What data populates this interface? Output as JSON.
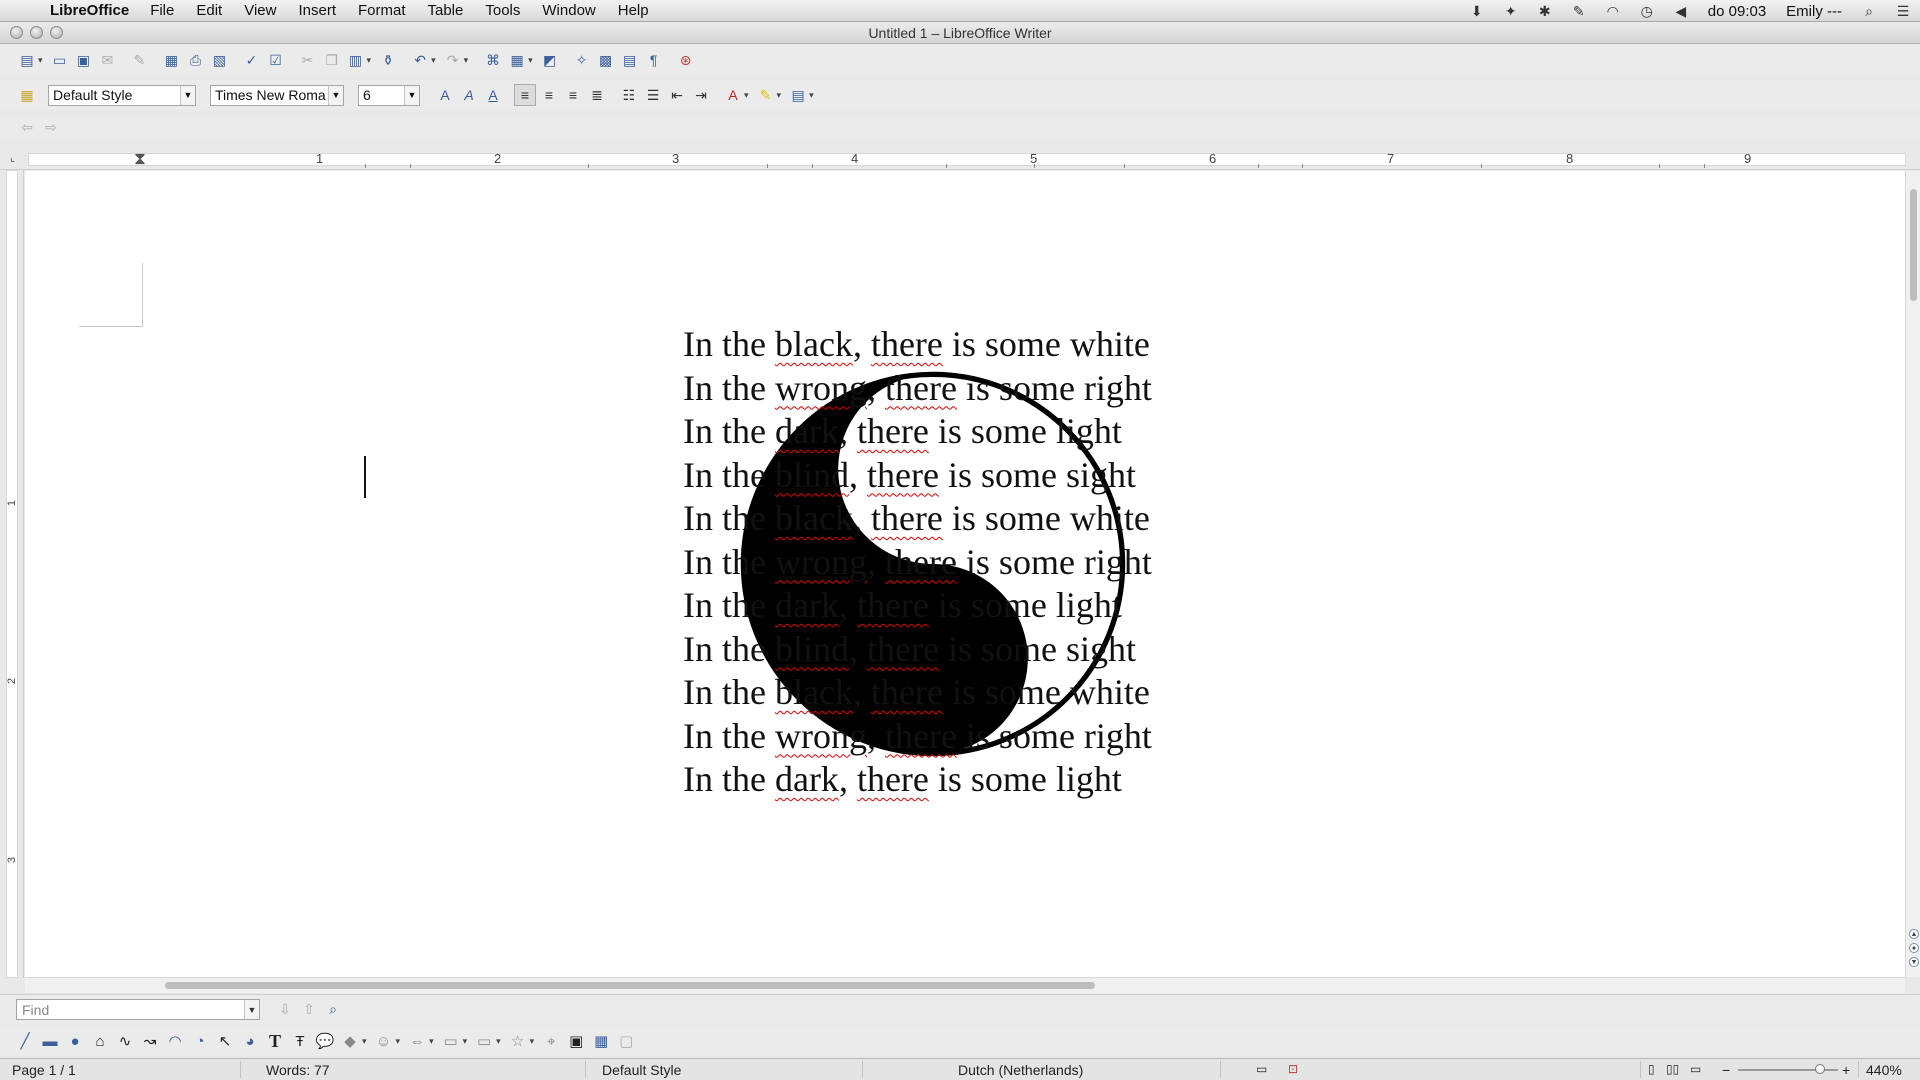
{
  "menubar": {
    "apple_glyph": "",
    "app_name": "LibreOffice",
    "menus": [
      "File",
      "Edit",
      "View",
      "Insert",
      "Format",
      "Table",
      "Tools",
      "Window",
      "Help"
    ],
    "clock": "do 09:03",
    "user": "Emily ---"
  },
  "window": {
    "title": "Untitled 1 – LibreOffice Writer"
  },
  "formatting": {
    "paragraph_style": "Default Style",
    "font_name": "Times New Roma",
    "font_size": "6"
  },
  "ruler": {
    "numbers": [
      "1",
      "2",
      "3",
      "4",
      "5",
      "6",
      "7",
      "8",
      "9"
    ],
    "vertical_numbers": [
      "1",
      "2",
      "3"
    ]
  },
  "document": {
    "lines": [
      [
        "In the ",
        "black",
        ", ",
        "there",
        " is some white"
      ],
      [
        "In the ",
        "wrong",
        ", ",
        "there",
        " is some right"
      ],
      [
        "In the ",
        "dark",
        ", ",
        "there",
        " is some light"
      ],
      [
        "In the ",
        "blind",
        ", ",
        "there",
        " is some sight"
      ],
      [
        "In the ",
        "black",
        ", ",
        "there",
        " is some white"
      ],
      [
        "In the ",
        "wrong",
        ", ",
        "there",
        " is some right"
      ],
      [
        "In the ",
        "dark",
        ", ",
        "there",
        " is some light"
      ],
      [
        "In the ",
        "blind",
        ", ",
        "there",
        " is some sight"
      ],
      [
        "In the ",
        "black",
        ", ",
        "there",
        " is some white"
      ],
      [
        "In the ",
        "wrong",
        ", ",
        "there",
        " is some right"
      ],
      [
        "In the ",
        "dark",
        ", ",
        "there",
        " is some light"
      ]
    ]
  },
  "findbar": {
    "placeholder": "Find"
  },
  "statusbar": {
    "page": "Page 1 / 1",
    "words": "Words: 77",
    "page_style": "Default Style",
    "language": "Dutch (Netherlands)",
    "zoom": "440%",
    "zoom_fraction": 0.82
  },
  "colors": {
    "spellcheck_underline": "#d00000",
    "toolbar_icon": "#3a5f9a"
  }
}
